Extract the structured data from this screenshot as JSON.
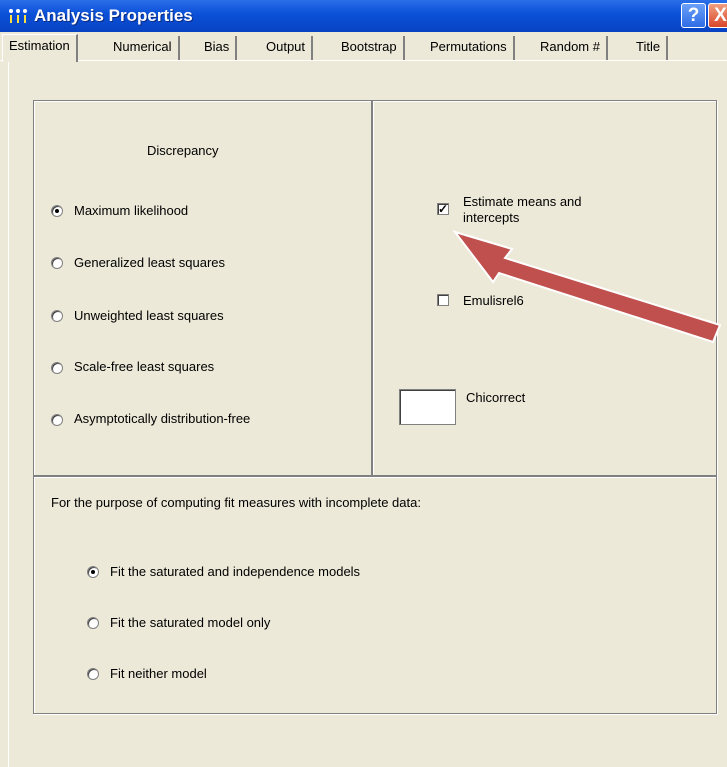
{
  "window": {
    "title": "Analysis Properties",
    "help_label": "?",
    "close_label": "X"
  },
  "tabs": [
    {
      "label": "Estimation",
      "active": true
    },
    {
      "label": "Numerical",
      "active": false
    },
    {
      "label": "Bias",
      "active": false
    },
    {
      "label": "Output",
      "active": false
    },
    {
      "label": "Bootstrap",
      "active": false
    },
    {
      "label": "Permutations",
      "active": false
    },
    {
      "label": "Random #",
      "active": false
    },
    {
      "label": "Title",
      "active": false
    }
  ],
  "discrepancy": {
    "heading": "Discrepancy",
    "options": [
      {
        "label": "Maximum likelihood",
        "selected": true
      },
      {
        "label": "Generalized least squares",
        "selected": false
      },
      {
        "label": "Unweighted least squares",
        "selected": false
      },
      {
        "label": "Scale-free least squares",
        "selected": false
      },
      {
        "label": "Asymptotically  distribution-free",
        "selected": false
      }
    ]
  },
  "options": {
    "estimate_means_line1": "Estimate means and",
    "estimate_means_line2": "intercepts",
    "estimate_means_checked": true,
    "emulisrel_label": "Emulisrel6",
    "emulisrel_checked": false,
    "chicorrect_label": "Chicorrect",
    "chicorrect_value": ""
  },
  "incomplete": {
    "heading": "For the purpose of computing fit measures with incomplete data:",
    "options": [
      {
        "label": "Fit the saturated and independence models",
        "selected": true
      },
      {
        "label": "Fit the saturated model only",
        "selected": false
      },
      {
        "label": "Fit neither model",
        "selected": false
      }
    ]
  },
  "colors": {
    "titlebar": "#0a50d8",
    "arrow": "#c0504d",
    "dialog": "#ece9d8"
  }
}
